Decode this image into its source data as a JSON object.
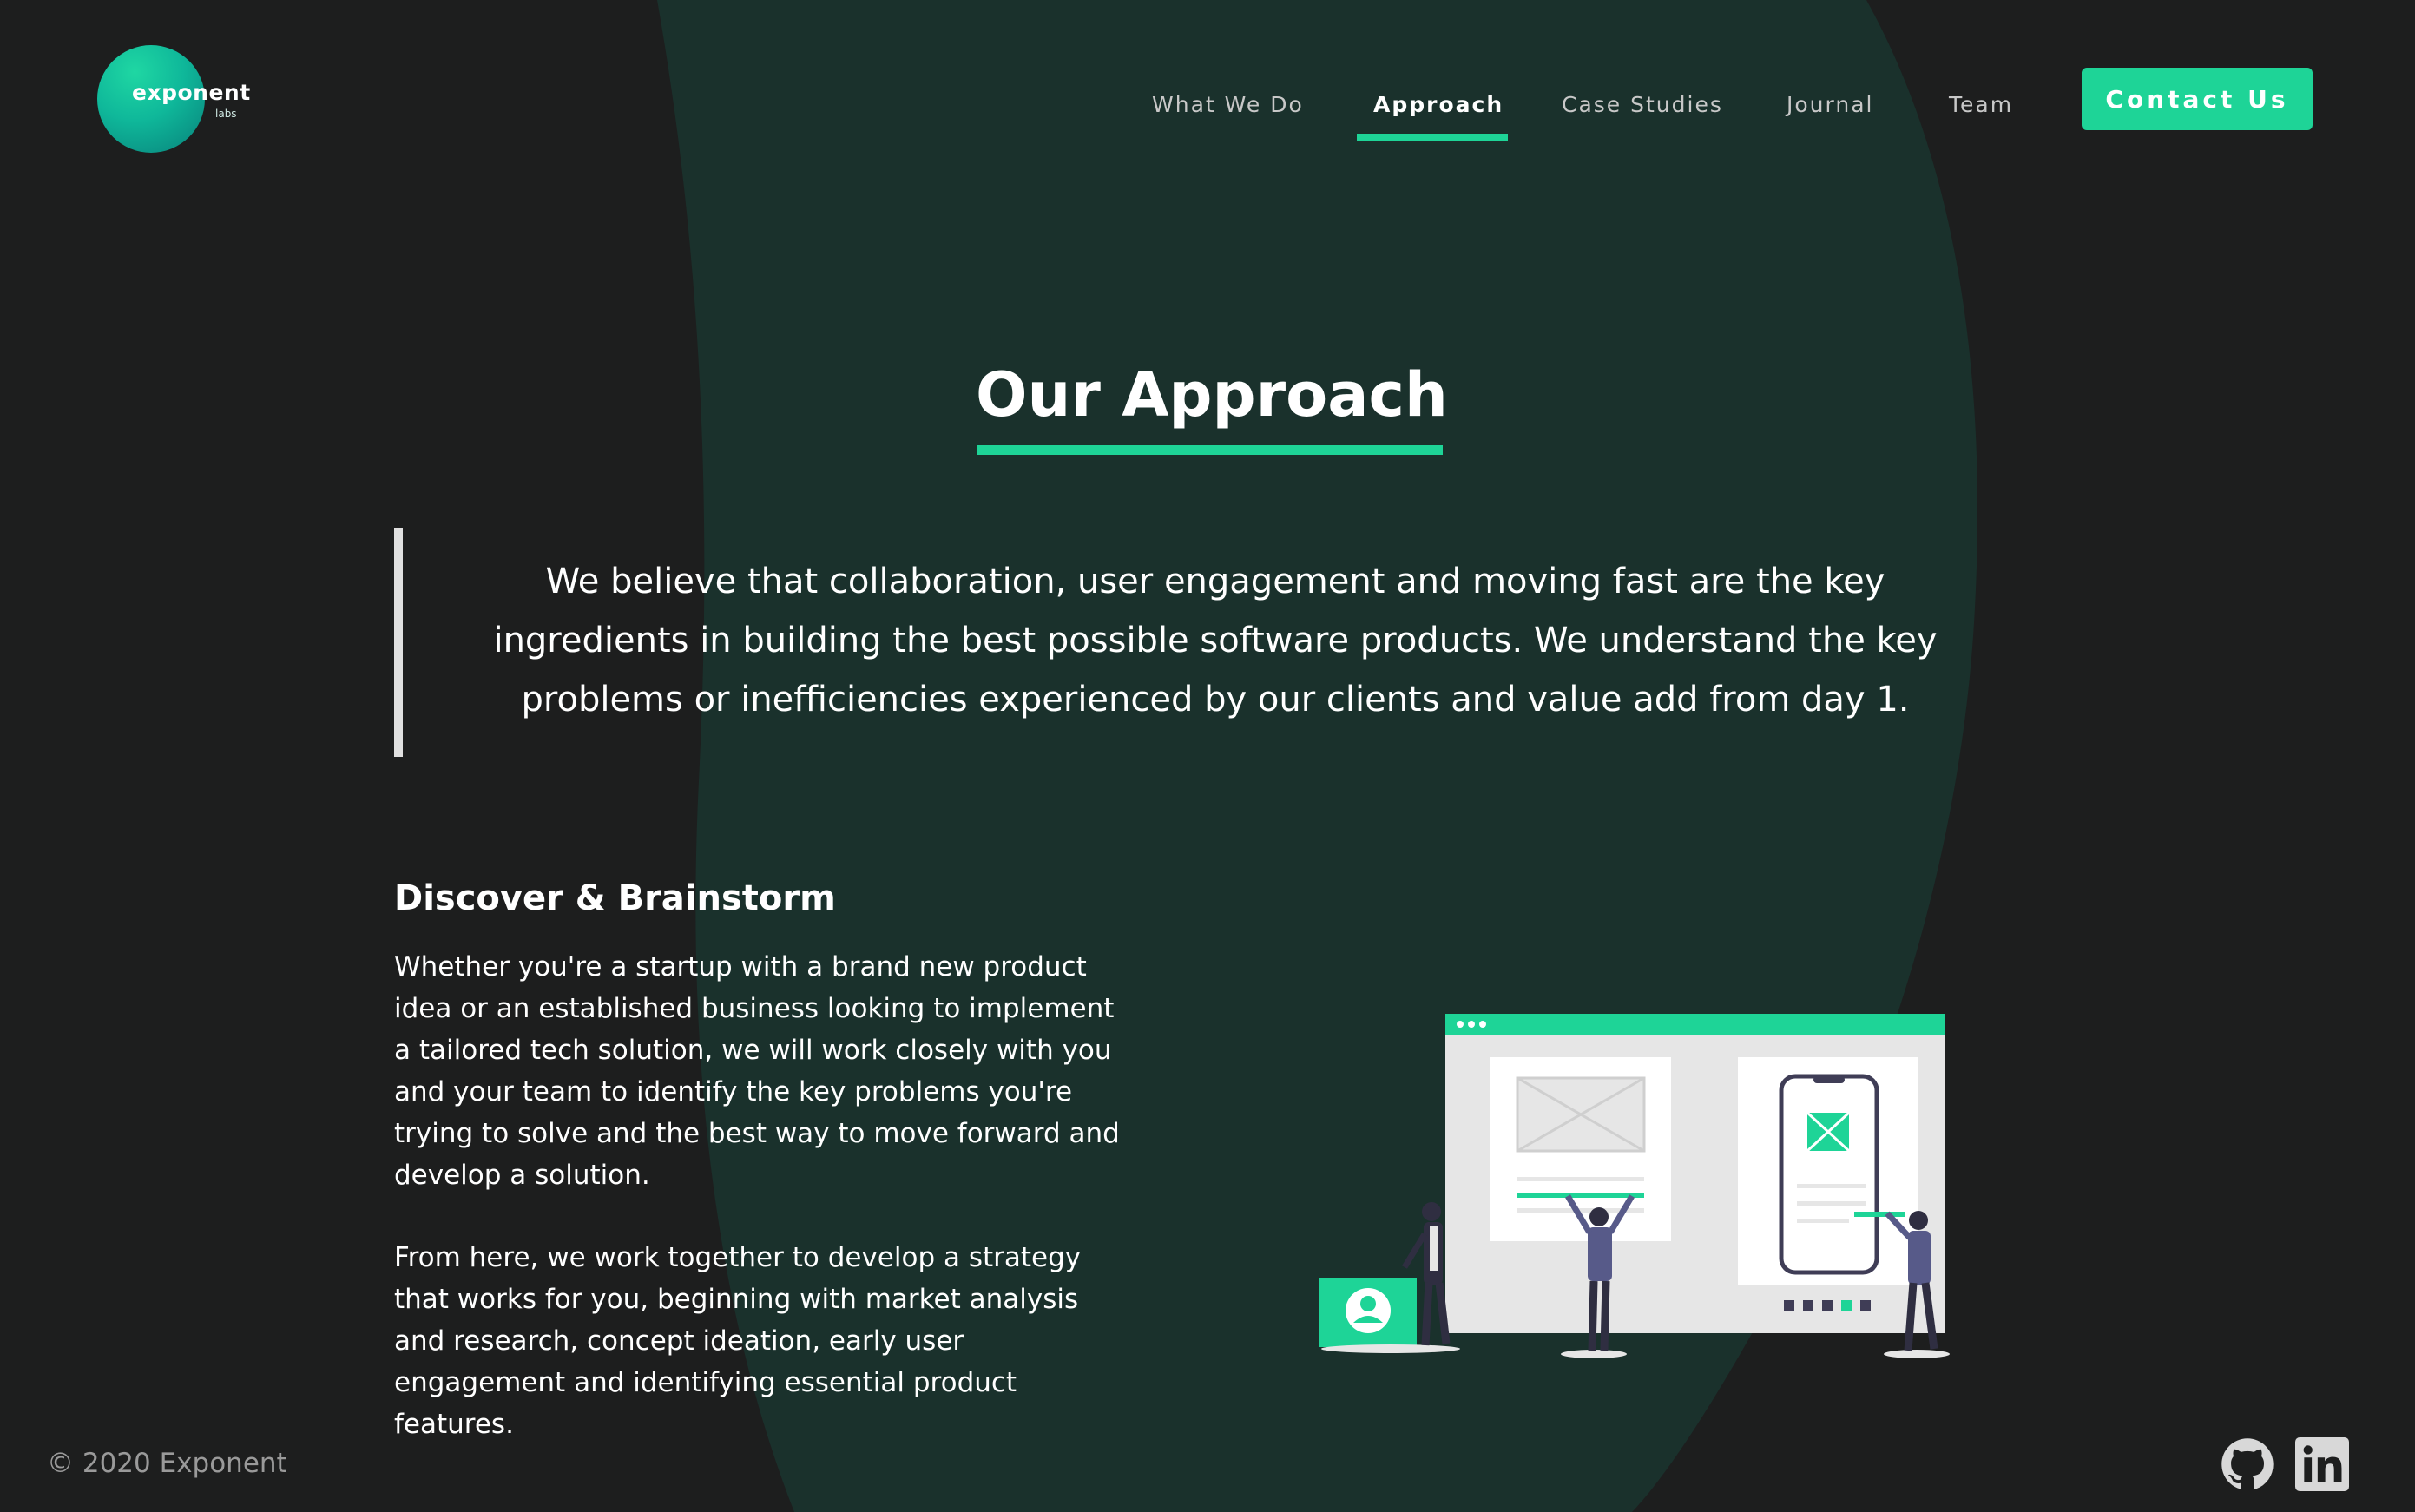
{
  "brand": {
    "name": "exponent",
    "sub": "labs"
  },
  "nav": {
    "items": [
      {
        "label": "What We Do"
      },
      {
        "label": "Approach"
      },
      {
        "label": "Case Studies"
      },
      {
        "label": "Journal"
      },
      {
        "label": "Team"
      }
    ],
    "active_item": "Approach",
    "contact_label": "Contact Us"
  },
  "hero": {
    "title": "Our Approach",
    "quote": "We believe that collaboration, user engagement and moving fast are the key ingredients in building the best possible software products. We understand the key problems or inefficiencies experienced by our clients and value add from day 1."
  },
  "section": {
    "title": "Discover & Brainstorm",
    "paragraphs": [
      "Whether you're a startup with a brand new product idea or an established business looking to implement a tailored tech solution, we will work closely with you and your team to identify the key problems you're trying to solve and the best way to move forward and develop a solution.",
      "From here, we work together to develop a strategy that works for you, beginning with market analysis and research, concept ideation, early user engagement and identifying essential product features."
    ]
  },
  "footer": {
    "copyright": "© 2020 Exponent",
    "icons": [
      "github-icon",
      "linkedin-icon"
    ]
  },
  "colors": {
    "accent": "#1ed497",
    "background": "#1d1e1e",
    "blob": "#1a312c"
  }
}
